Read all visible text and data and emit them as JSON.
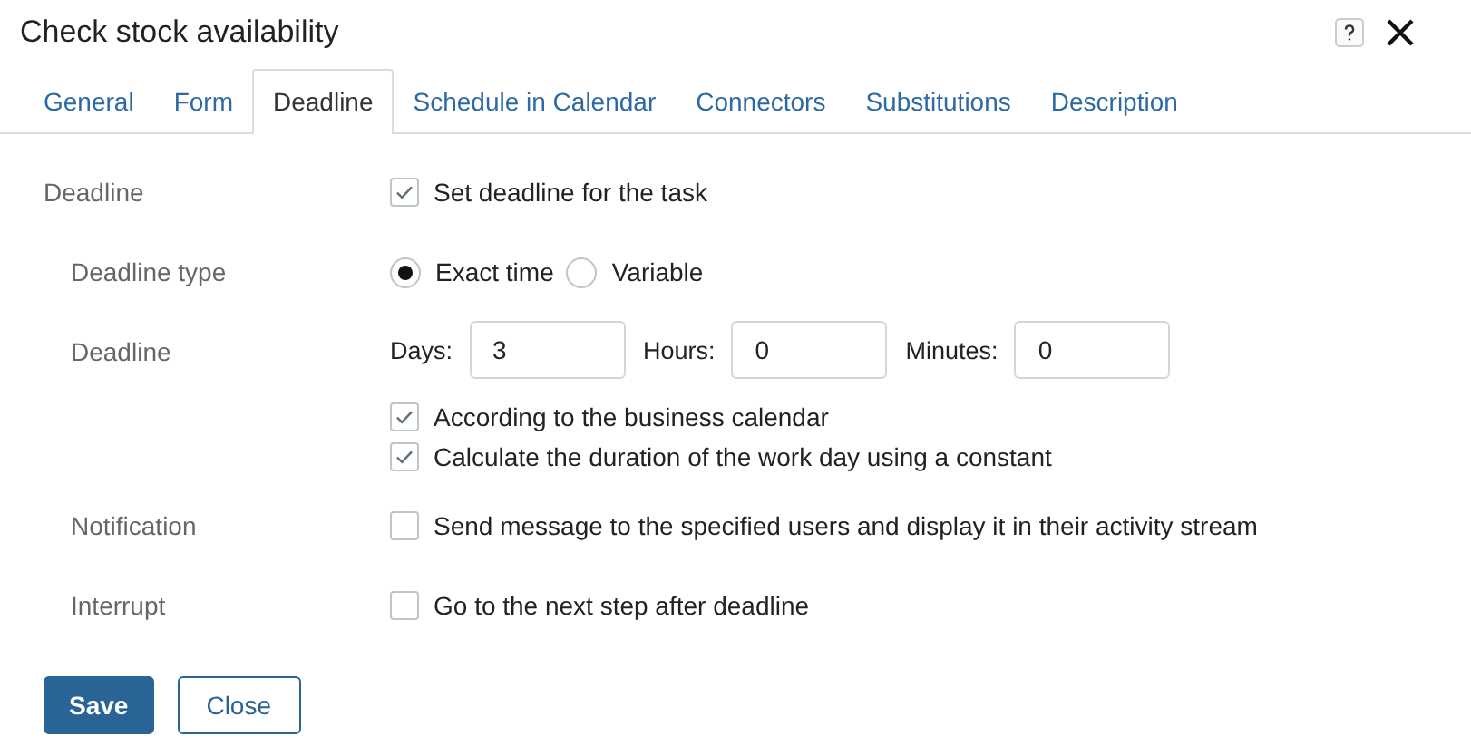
{
  "window": {
    "title": "Check stock availability"
  },
  "tabs": [
    {
      "label": "General",
      "selected": false
    },
    {
      "label": "Form",
      "selected": false
    },
    {
      "label": "Deadline",
      "selected": true
    },
    {
      "label": "Schedule in Calendar",
      "selected": false
    },
    {
      "label": "Connectors",
      "selected": false
    },
    {
      "label": "Substitutions",
      "selected": false
    },
    {
      "label": "Description",
      "selected": false
    }
  ],
  "rows": [
    {
      "label": "Deadline",
      "kind": "checkbox",
      "options": [
        {
          "text": "Set deadline for the task",
          "checked": true
        }
      ],
      "children": [
        {
          "label": "Deadline type",
          "kind": "radio",
          "options": [
            {
              "text": "Exact time",
              "selected": true
            },
            {
              "text": "Variable",
              "selected": false
            }
          ]
        },
        {
          "label": "Deadline",
          "kind": "duration",
          "fields": [
            {
              "label": "Days:",
              "value": "3"
            },
            {
              "label": "Hours:",
              "value": "0"
            },
            {
              "label": "Minutes:",
              "value": "0"
            }
          ],
          "options": [
            {
              "text": "According to the business calendar",
              "checked": true
            },
            {
              "text": "Calculate the duration of the work day using a constant",
              "checked": true
            }
          ]
        },
        {
          "label": "Notification",
          "kind": "checkbox",
          "options": [
            {
              "text": "Send message to the specified users and display it in their activity stream",
              "checked": false
            }
          ]
        },
        {
          "label": "Interrupt",
          "kind": "checkbox",
          "options": [
            {
              "text": "Go to the next step after deadline",
              "checked": false
            }
          ]
        }
      ]
    }
  ],
  "buttons": [
    {
      "label": "Save",
      "kind": "primary"
    },
    {
      "label": "Close",
      "kind": "secondary"
    }
  ]
}
